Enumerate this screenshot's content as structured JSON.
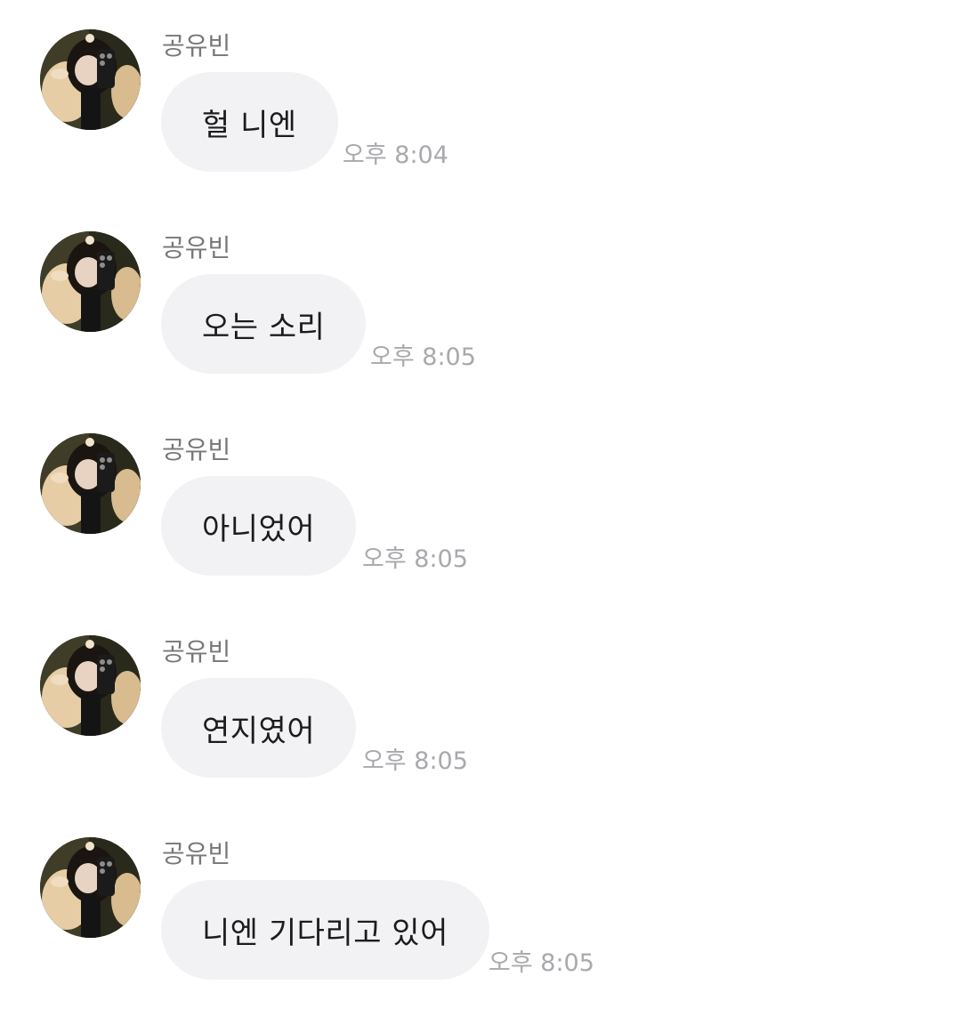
{
  "messages": [
    {
      "sender": "공유빈",
      "text": "헐 니엔",
      "time": "오후 8:04",
      "avatar": "profile-photo"
    },
    {
      "sender": "공유빈",
      "text": "오는 소리",
      "time": "오후 8:05",
      "avatar": "profile-photo"
    },
    {
      "sender": "공유빈",
      "text": "아니었어",
      "time": "오후 8:05",
      "avatar": "profile-photo"
    },
    {
      "sender": "공유빈",
      "text": "연지였어",
      "time": "오후 8:05",
      "avatar": "profile-photo"
    },
    {
      "sender": "공유빈",
      "text": "니엔 기다리고 있어",
      "time": "오후 8:05",
      "avatar": "profile-photo"
    }
  ],
  "colors": {
    "bubble": "#f2f2f4",
    "sender": "#777777",
    "time": "#a9a9ad",
    "text": "#1c1c1e",
    "background": "#ffffff"
  }
}
